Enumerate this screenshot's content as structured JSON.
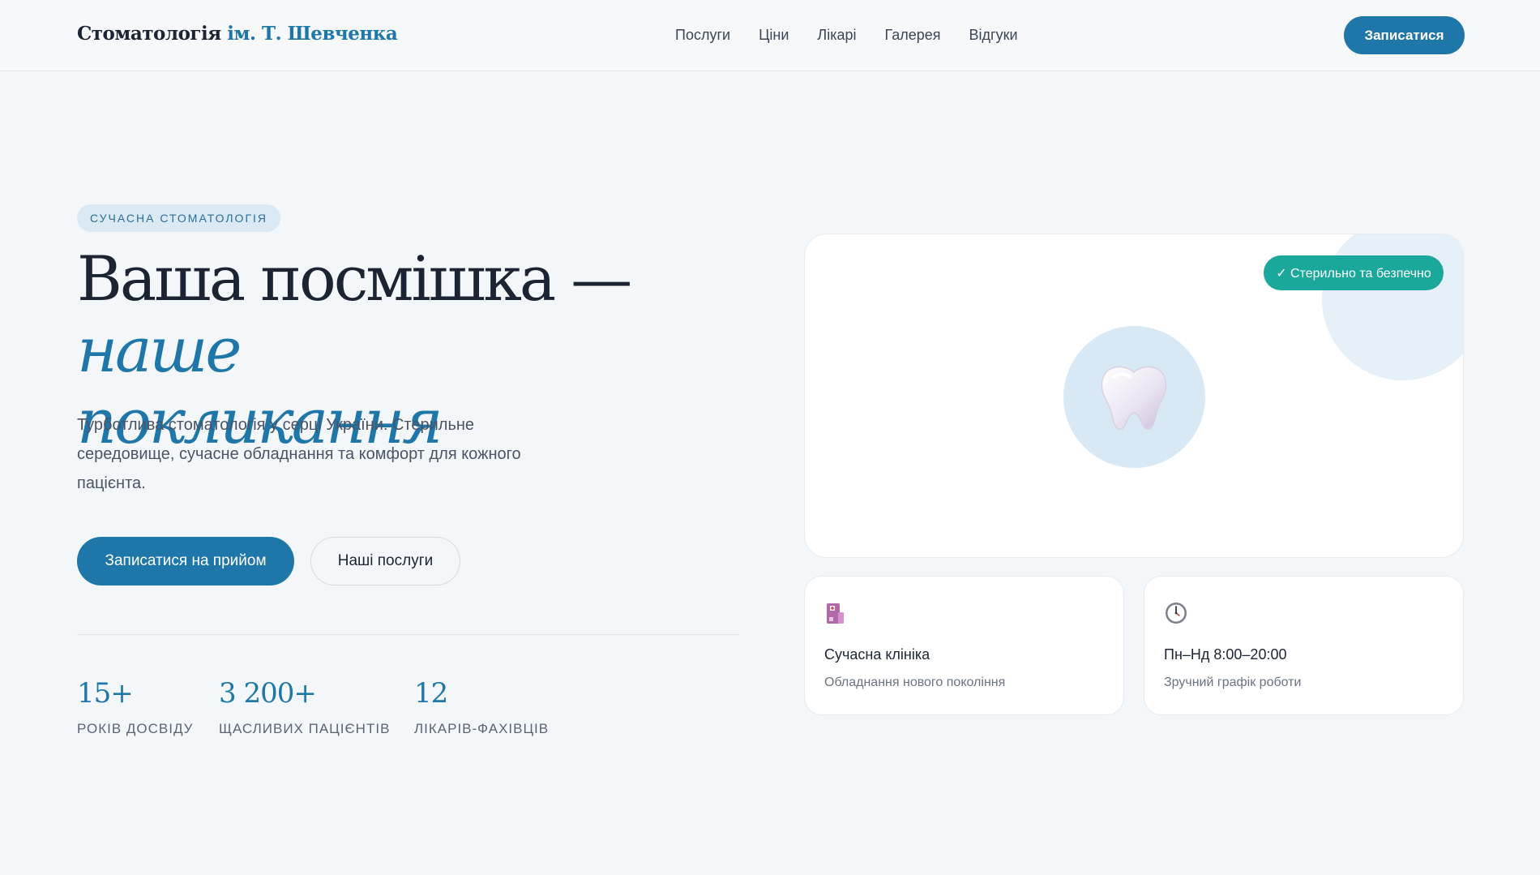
{
  "header": {
    "brand_main": "Стоматологія",
    "brand_accent": "ім. Т. Шевченка",
    "nav": [
      "Послуги",
      "Ціни",
      "Лікарі",
      "Галерея",
      "Відгуки"
    ],
    "cta": "Записатися"
  },
  "hero": {
    "eyebrow": "СУЧАСНА СТОМАТОЛОГІЯ",
    "title_main": "Ваша посмішка —",
    "title_em_1": "наше",
    "title_em_2": "покликання",
    "description": "Турботлива стоматологія у серці України. Стерильне середовище, сучасне обладнання та комфорт для кожного пацієнта.",
    "primary_button": "Записатися на прийом",
    "secondary_button": "Наші послуги",
    "stats": [
      {
        "value": "15+",
        "label": "РОКІВ ДОСВІДУ"
      },
      {
        "value": "3 200+",
        "label": "ЩАСЛИВИХ ПАЦІЄНТІВ"
      },
      {
        "value": "12",
        "label": "ЛІКАРІВ-ФАХІВЦІВ"
      }
    ]
  },
  "visual": {
    "badge": "✓ Стерильно та безпечно",
    "icon": "tooth-icon"
  },
  "features": [
    {
      "icon": "clinic-building-icon",
      "title": "Сучасна клініка",
      "subtitle": "Обладнання нового покоління"
    },
    {
      "icon": "clock-icon",
      "title": "Пн–Нд 8:00–20:00",
      "subtitle": "Зручний графік роботи"
    }
  ],
  "colors": {
    "accent": "#1f76a8",
    "teal": "#1aa89a",
    "background": "#f4f7fa"
  }
}
